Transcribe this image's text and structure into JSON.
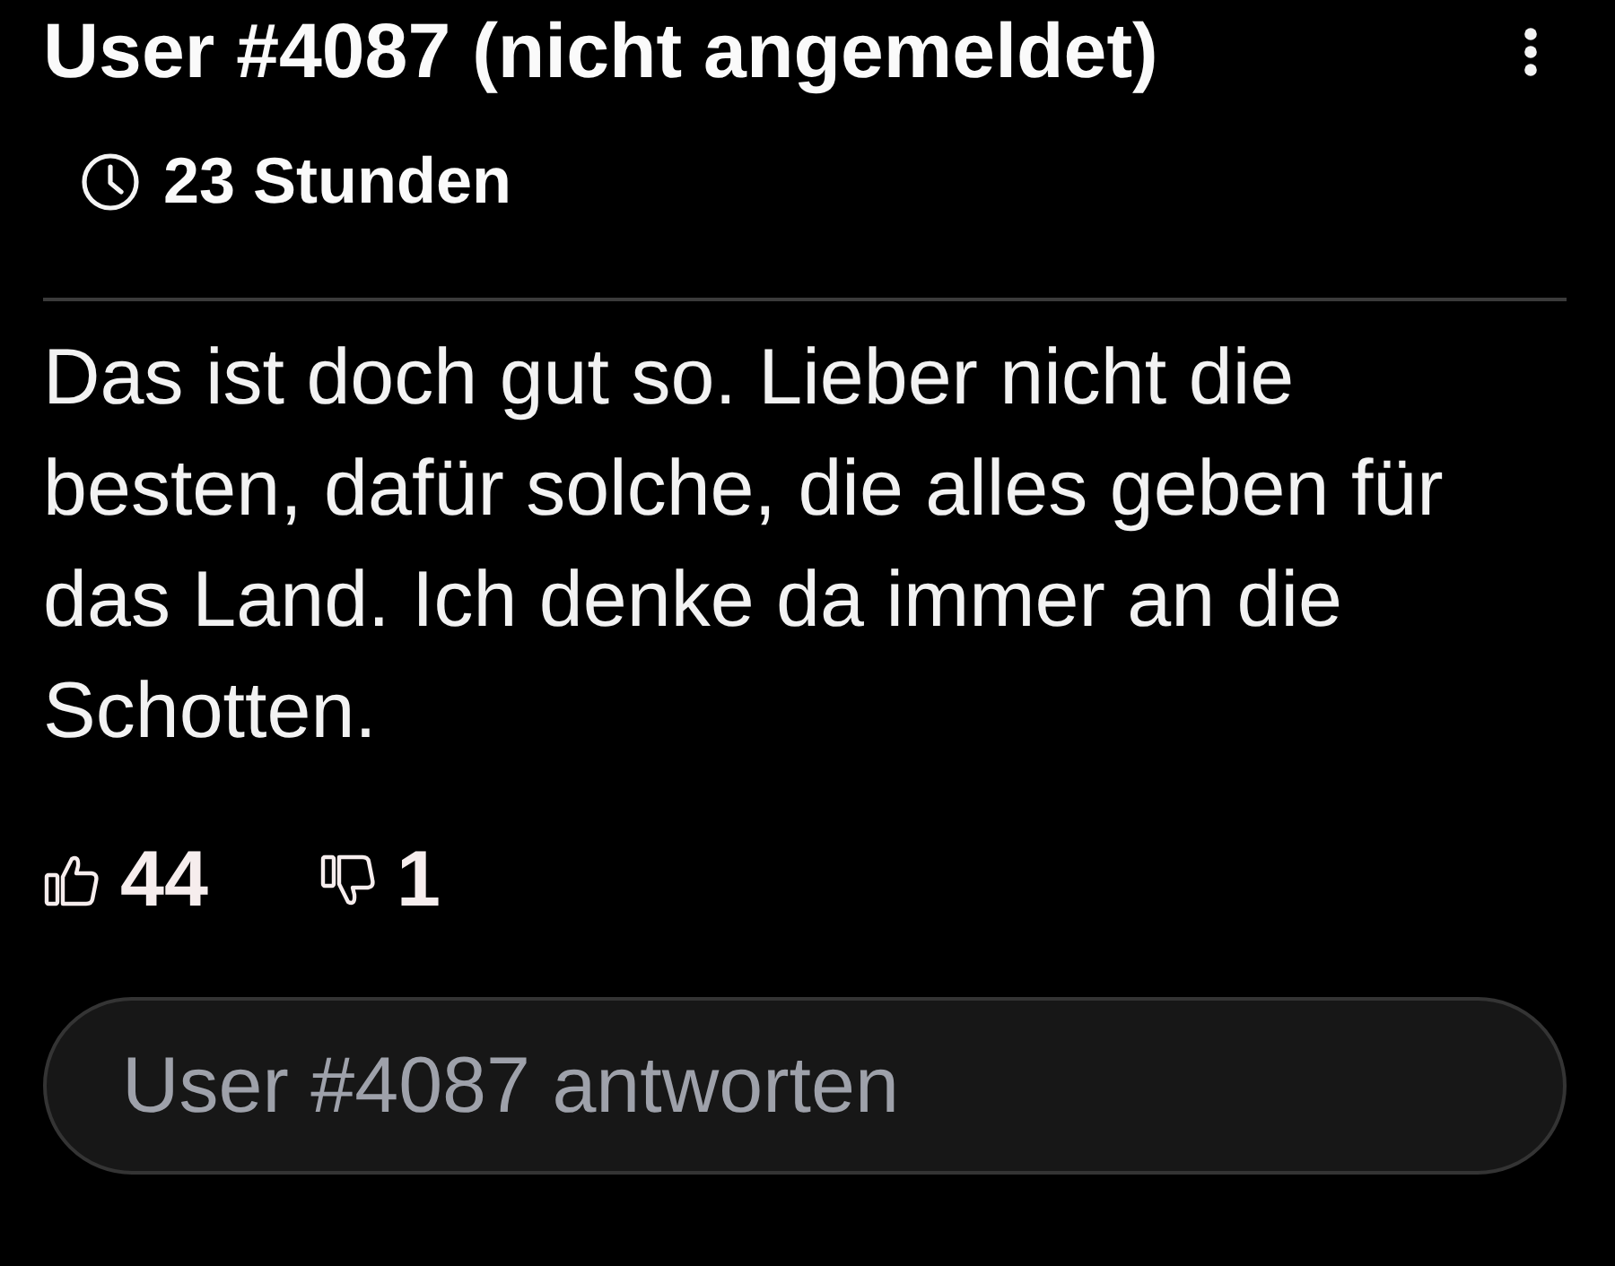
{
  "comment": {
    "author": "User #4087 (nicht angemeldet)",
    "time": "23 Stunden",
    "text": "Das ist doch gut so. Lieber nicht die besten, dafür solche, die alles geben für das Land. Ich denke da immer an die Schotten.",
    "votes": [
      {
        "kind": "up",
        "count": "44"
      },
      {
        "kind": "down",
        "count": "1"
      }
    ],
    "reply": {
      "placeholder": "User #4087 antworten"
    }
  }
}
